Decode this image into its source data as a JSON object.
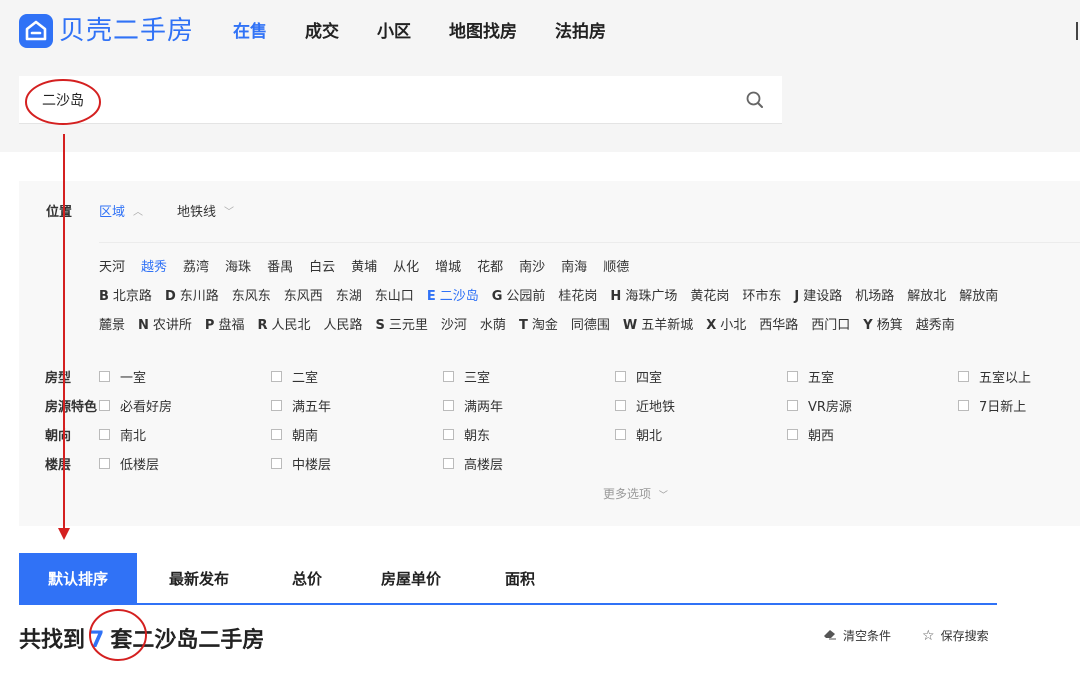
{
  "header": {
    "logo_text": "贝壳二手房",
    "nav": [
      {
        "label": "在售",
        "active": true
      },
      {
        "label": "成交",
        "active": false
      },
      {
        "label": "小区",
        "active": false
      },
      {
        "label": "地图找房",
        "active": false
      },
      {
        "label": "法拍房",
        "active": false
      }
    ],
    "search": {
      "value": "二沙岛",
      "icon": "search-icon"
    }
  },
  "filter": {
    "position_label": "位置",
    "tabs": [
      {
        "label": "区域",
        "active": true,
        "icon": "chevron-up-icon"
      },
      {
        "label": "地铁线",
        "active": false,
        "icon": "chevron-down-icon"
      }
    ],
    "districts": [
      "天河",
      "越秀",
      "荔湾",
      "海珠",
      "番禺",
      "白云",
      "黄埔",
      "从化",
      "增城",
      "花都",
      "南沙",
      "南海",
      "顺德"
    ],
    "active_district": "越秀",
    "areas_row1": [
      {
        "letter": "B",
        "name": "北京路"
      },
      {
        "letter": "D",
        "name": "东川路"
      },
      {
        "letter": "",
        "name": "东风东"
      },
      {
        "letter": "",
        "name": "东风西"
      },
      {
        "letter": "",
        "name": "东湖"
      },
      {
        "letter": "",
        "name": "东山口"
      },
      {
        "letter": "E",
        "name": "二沙岛",
        "active": true
      },
      {
        "letter": "G",
        "name": "公园前"
      },
      {
        "letter": "",
        "name": "桂花岗"
      },
      {
        "letter": "H",
        "name": "海珠广场"
      },
      {
        "letter": "",
        "name": "黄花岗"
      },
      {
        "letter": "",
        "name": "环市东"
      },
      {
        "letter": "J",
        "name": "建设路"
      },
      {
        "letter": "",
        "name": "机场路"
      },
      {
        "letter": "",
        "name": "解放北"
      },
      {
        "letter": "",
        "name": "解放南"
      }
    ],
    "areas_row2": [
      {
        "letter": "",
        "name": "麓景"
      },
      {
        "letter": "N",
        "name": "农讲所"
      },
      {
        "letter": "P",
        "name": "盘福"
      },
      {
        "letter": "R",
        "name": "人民北"
      },
      {
        "letter": "",
        "name": "人民路"
      },
      {
        "letter": "S",
        "name": "三元里"
      },
      {
        "letter": "",
        "name": "沙河"
      },
      {
        "letter": "",
        "name": "水荫"
      },
      {
        "letter": "T",
        "name": "淘金"
      },
      {
        "letter": "",
        "name": "同德围"
      },
      {
        "letter": "W",
        "name": "五羊新城"
      },
      {
        "letter": "X",
        "name": "小北"
      },
      {
        "letter": "",
        "name": "西华路"
      },
      {
        "letter": "",
        "name": "西门口"
      },
      {
        "letter": "Y",
        "name": "杨箕"
      },
      {
        "letter": "",
        "name": "越秀南"
      }
    ],
    "option_rows": [
      {
        "label": "房型",
        "options": [
          "一室",
          "二室",
          "三室",
          "四室",
          "五室",
          "五室以上"
        ]
      },
      {
        "label": "房源特色",
        "options": [
          "必看好房",
          "满五年",
          "满两年",
          "近地铁",
          "VR房源",
          "7日新上"
        ]
      },
      {
        "label": "朝向",
        "options": [
          "南北",
          "朝南",
          "朝东",
          "朝北",
          "朝西"
        ]
      },
      {
        "label": "楼层",
        "options": [
          "低楼层",
          "中楼层",
          "高楼层"
        ]
      }
    ],
    "more_label": "更多选项",
    "more_icon": "chevron-down-icon"
  },
  "sort_tabs": [
    {
      "label": "默认排序",
      "active": true
    },
    {
      "label": "最新发布",
      "active": false
    },
    {
      "label": "总价",
      "active": false
    },
    {
      "label": "房屋单价",
      "active": false
    },
    {
      "label": "面积",
      "active": false
    }
  ],
  "result": {
    "prefix": "共找到",
    "count": "7",
    "suffix": "套",
    "title": "二沙岛二手房"
  },
  "tools": [
    {
      "label": "清空条件",
      "icon": "eraser-icon"
    },
    {
      "label": "保存搜索",
      "icon": "star-icon"
    }
  ],
  "colors": {
    "accent": "#3072f6",
    "annotation": "#d42020"
  }
}
